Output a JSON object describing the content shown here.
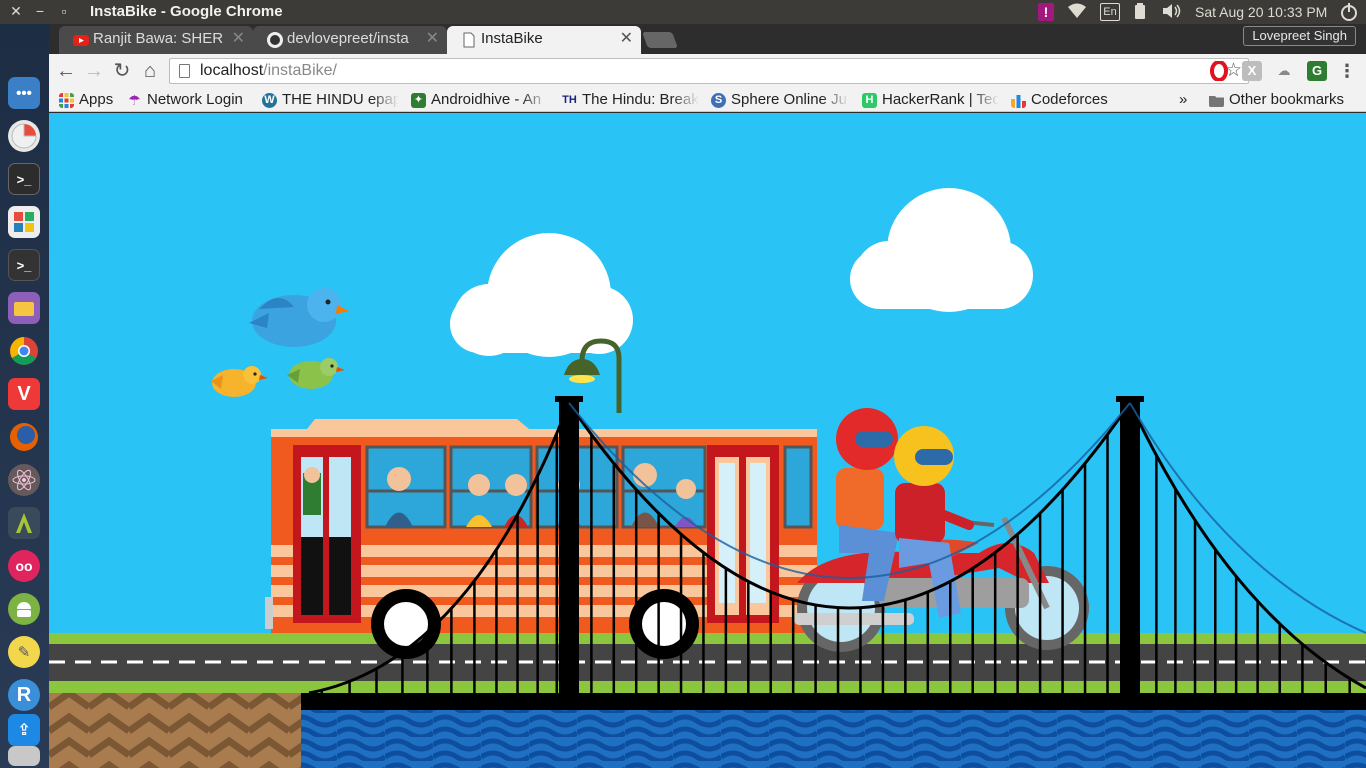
{
  "window": {
    "title": "InstaBike - Google Chrome"
  },
  "panel": {
    "keyboard_layout": "En",
    "datetime": "Sat Aug 20 10:33 PM",
    "icons": [
      "alert-icon",
      "wifi-icon",
      "keyboard-icon",
      "battery-icon",
      "volume-icon",
      "power-icon"
    ]
  },
  "launcher": {
    "apps": [
      "apple-icon",
      "dash-icon",
      "pie-icon",
      "terminal-icon",
      "apps-grid-icon",
      "terminal-dark-icon",
      "files-icon",
      "chrome-icon",
      "vivaldi-icon",
      "firefox-icon",
      "atom-icon",
      "android-studio-icon",
      "flickr-icon",
      "android-icon",
      "notes-icon",
      "rstudio-icon",
      "uploader-icon",
      "archive-icon"
    ]
  },
  "tabs": [
    {
      "label": "Ranjit Bawa: SHER",
      "favicon": "youtube-icon",
      "active": false
    },
    {
      "label": "devlovepreet/insta",
      "favicon": "github-icon",
      "active": false
    },
    {
      "label": "InstaBike",
      "favicon": "page-icon",
      "active": true
    }
  ],
  "profile": {
    "name": "Lovepreet Singh"
  },
  "omnibox": {
    "host": "localhost",
    "path": "/instaBike/"
  },
  "bookmarks": {
    "items": [
      {
        "label": "Apps",
        "icon": "apps-grid-icon",
        "color": "#e53935"
      },
      {
        "label": "Network Login",
        "icon": "umbrella-icon",
        "color": "#9c27b0"
      },
      {
        "label": "THE HINDU epap",
        "icon": "wordpress-icon",
        "color": "#21759b"
      },
      {
        "label": "Androidhive - An",
        "icon": "androidhive-icon",
        "color": "#2e7d32"
      },
      {
        "label": "The Hindu: Break",
        "icon": "the-hindu-icon",
        "color": "#1a237e"
      },
      {
        "label": "Sphere Online Ju",
        "icon": "spoj-icon",
        "color": "#3f6fb5"
      },
      {
        "label": "HackerRank | Tec",
        "icon": "hackerrank-icon",
        "color": "#2ec866"
      },
      {
        "label": "Codeforces",
        "icon": "codeforces-icon",
        "color": "#f9a825"
      }
    ],
    "overflow": "»",
    "other": "Other bookmarks"
  },
  "colors": {
    "sky": "#29c4f5",
    "bus": "#f05a1f",
    "water": "#1f6fc2",
    "grass": "#8cc63f"
  }
}
